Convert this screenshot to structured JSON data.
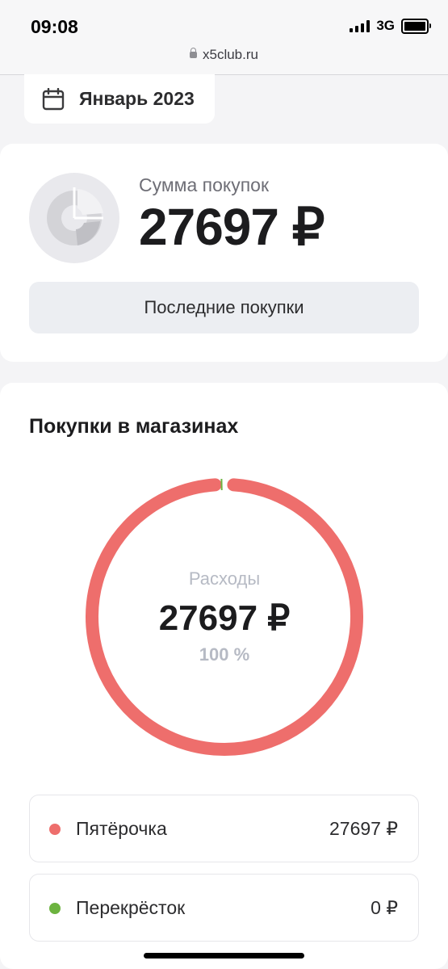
{
  "status_bar": {
    "time": "09:08",
    "network": "3G",
    "url": "x5club.ru"
  },
  "period": {
    "label": "Январь 2023",
    "icon": "calendar-icon"
  },
  "summary": {
    "label": "Сумма покупок",
    "value": "27697 ₽",
    "recent_button": "Последние покупки"
  },
  "shops": {
    "title": "Покупки в магазинах",
    "center_label": "Расходы",
    "center_value": "27697 ₽",
    "center_percent": "100 %",
    "items": [
      {
        "name": "Пятёрочка",
        "amount": "27697 ₽",
        "share": 1.0,
        "color": "#ee6e6c"
      },
      {
        "name": "Перекрёсток",
        "amount": "0 ₽",
        "share": 0.0,
        "color": "#6cb33f"
      }
    ]
  },
  "colors": {
    "accent_red": "#ee6e6c",
    "accent_green": "#6cb33f",
    "muted_text": "#b6bac4"
  }
}
